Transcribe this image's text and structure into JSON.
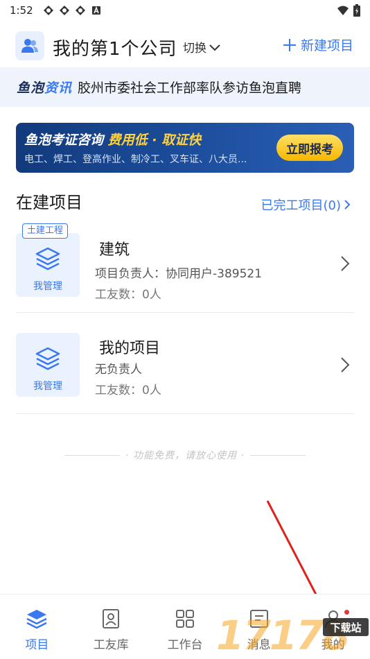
{
  "status_bar": {
    "time": "1:52",
    "notification_icons": [
      "sync-icon",
      "sync-icon",
      "sync-icon",
      "a-icon"
    ],
    "right_icons": [
      "wifi-icon",
      "battery-icon"
    ]
  },
  "header": {
    "company_name": "我的第1个公司",
    "switch_label": "切换",
    "new_project_label": "新建项目"
  },
  "news": {
    "brand_part1": "鱼泡",
    "brand_part2": "资讯",
    "headline": "胶州市委社会工作部率队参访鱼泡直聘"
  },
  "ad": {
    "title_main": "鱼泡考证咨询",
    "title_highlight": "费用低 · 取证快",
    "subtitle": "电工、焊工、登高作业、制冷工、叉车证、八大员...",
    "button_label": "立即报考"
  },
  "section": {
    "title": "在建项目",
    "completed_link": "已完工项目(0)"
  },
  "projects": [
    {
      "tag": "土建工程",
      "name": "建筑",
      "leader": "项目负责人：协同用户-389521",
      "workers": "工友数：0人",
      "role": "我管理"
    },
    {
      "tag": "",
      "name": "我的项目",
      "leader": "无负责人",
      "workers": "工友数：0人",
      "role": "我管理"
    }
  ],
  "free_note": "· 功能免费，请放心使用 ·",
  "bottom_nav": [
    {
      "label": "项目",
      "icon": "layers-icon",
      "active": true
    },
    {
      "label": "工友库",
      "icon": "contacts-icon",
      "active": false
    },
    {
      "label": "工作台",
      "icon": "grid-icon",
      "active": false
    },
    {
      "label": "消息",
      "icon": "message-icon",
      "active": false
    },
    {
      "label": "我的",
      "icon": "profile-icon",
      "active": false
    }
  ],
  "watermark": {
    "text": "17178",
    "badge": "下载站"
  },
  "colors": {
    "accent": "#3a78ef",
    "news_bg": "#eef3fc",
    "ad_bg": "#1d4f9e",
    "ad_button": "#f5b700",
    "badge_dot": "#e53935"
  }
}
